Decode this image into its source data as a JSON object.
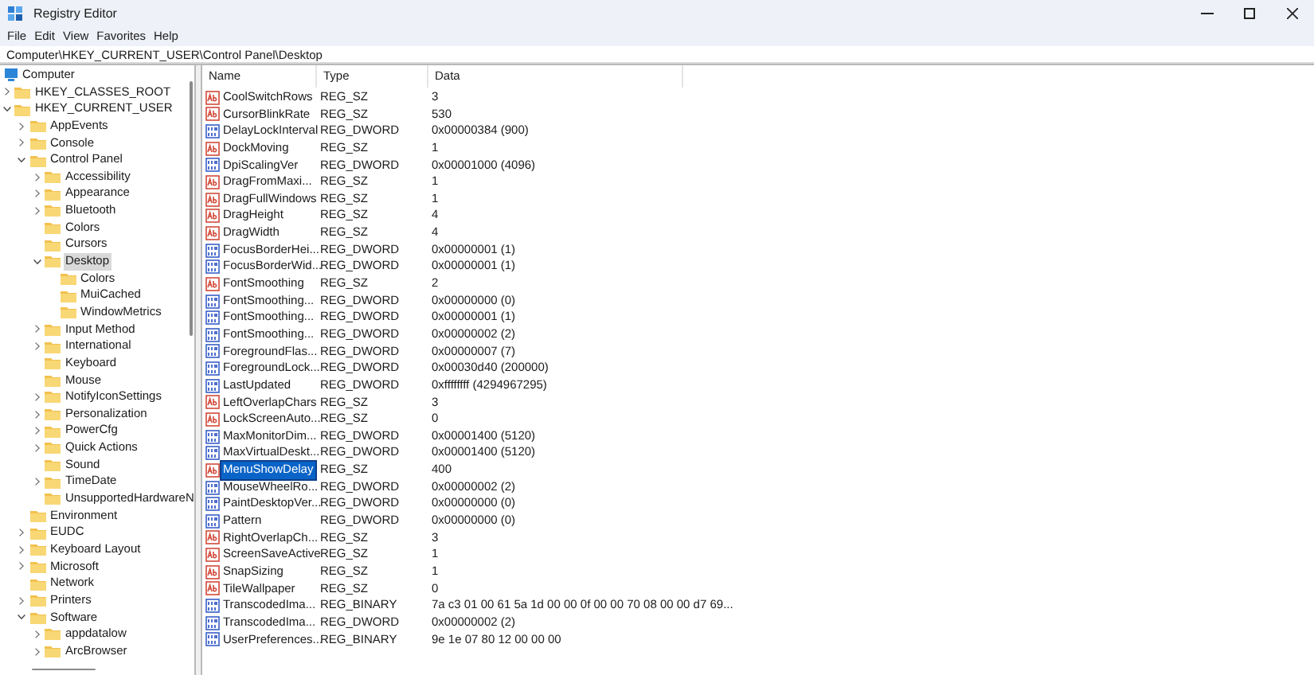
{
  "window": {
    "title": "Registry Editor"
  },
  "menu": [
    "File",
    "Edit",
    "View",
    "Favorites",
    "Help"
  ],
  "address": "Computer\\HKEY_CURRENT_USER\\Control Panel\\Desktop",
  "tree": {
    "root": "Computer",
    "nodes": [
      {
        "label": "HKEY_CLASSES_ROOT",
        "expandable": true,
        "expanded": false,
        "selected": false
      },
      {
        "label": "HKEY_CURRENT_USER",
        "expandable": true,
        "expanded": true,
        "selected": false,
        "children": [
          {
            "label": "AppEvents",
            "expandable": true,
            "expanded": false,
            "selected": false
          },
          {
            "label": "Console",
            "expandable": true,
            "expanded": false,
            "selected": false
          },
          {
            "label": "Control Panel",
            "expandable": true,
            "expanded": true,
            "selected": false,
            "children": [
              {
                "label": "Accessibility",
                "expandable": true,
                "expanded": false,
                "selected": false
              },
              {
                "label": "Appearance",
                "expandable": true,
                "expanded": false,
                "selected": false
              },
              {
                "label": "Bluetooth",
                "expandable": true,
                "expanded": false,
                "selected": false
              },
              {
                "label": "Colors",
                "expandable": false,
                "expanded": false,
                "selected": false
              },
              {
                "label": "Cursors",
                "expandable": false,
                "expanded": false,
                "selected": false
              },
              {
                "label": "Desktop",
                "expandable": true,
                "expanded": true,
                "selected": true,
                "children": [
                  {
                    "label": "Colors",
                    "expandable": false,
                    "expanded": false,
                    "selected": false
                  },
                  {
                    "label": "MuiCached",
                    "expandable": false,
                    "expanded": false,
                    "selected": false
                  },
                  {
                    "label": "WindowMetrics",
                    "expandable": false,
                    "expanded": false,
                    "selected": false
                  }
                ]
              },
              {
                "label": "Input Method",
                "expandable": true,
                "expanded": false,
                "selected": false
              },
              {
                "label": "International",
                "expandable": true,
                "expanded": false,
                "selected": false
              },
              {
                "label": "Keyboard",
                "expandable": false,
                "expanded": false,
                "selected": false
              },
              {
                "label": "Mouse",
                "expandable": false,
                "expanded": false,
                "selected": false
              },
              {
                "label": "NotifyIconSettings",
                "expandable": true,
                "expanded": false,
                "selected": false
              },
              {
                "label": "Personalization",
                "expandable": true,
                "expanded": false,
                "selected": false
              },
              {
                "label": "PowerCfg",
                "expandable": true,
                "expanded": false,
                "selected": false
              },
              {
                "label": "Quick Actions",
                "expandable": true,
                "expanded": false,
                "selected": false
              },
              {
                "label": "Sound",
                "expandable": false,
                "expanded": false,
                "selected": false
              },
              {
                "label": "TimeDate",
                "expandable": true,
                "expanded": false,
                "selected": false
              },
              {
                "label": "UnsupportedHardwareN",
                "expandable": false,
                "expanded": false,
                "selected": false
              }
            ]
          },
          {
            "label": "Environment",
            "expandable": false,
            "expanded": false,
            "selected": false
          },
          {
            "label": "EUDC",
            "expandable": true,
            "expanded": false,
            "selected": false
          },
          {
            "label": "Keyboard Layout",
            "expandable": true,
            "expanded": false,
            "selected": false
          },
          {
            "label": "Microsoft",
            "expandable": true,
            "expanded": false,
            "selected": false
          },
          {
            "label": "Network",
            "expandable": false,
            "expanded": false,
            "selected": false
          },
          {
            "label": "Printers",
            "expandable": true,
            "expanded": false,
            "selected": false
          },
          {
            "label": "Software",
            "expandable": true,
            "expanded": true,
            "selected": false,
            "children": [
              {
                "label": "appdatalow",
                "expandable": true,
                "expanded": false,
                "selected": false
              },
              {
                "label": "ArcBrowser",
                "expandable": true,
                "expanded": false,
                "selected": false
              }
            ]
          }
        ]
      }
    ]
  },
  "table": {
    "columns": [
      "Name",
      "Type",
      "Data"
    ],
    "rows": [
      {
        "kind": "string",
        "name": "CoolSwitchRows",
        "type": "REG_SZ",
        "data": "3",
        "selected": false
      },
      {
        "kind": "string",
        "name": "CursorBlinkRate",
        "type": "REG_SZ",
        "data": "530",
        "selected": false
      },
      {
        "kind": "binary",
        "name": "DelayLockInterval",
        "type": "REG_DWORD",
        "data": "0x00000384 (900)",
        "selected": false
      },
      {
        "kind": "string",
        "name": "DockMoving",
        "type": "REG_SZ",
        "data": "1",
        "selected": false
      },
      {
        "kind": "binary",
        "name": "DpiScalingVer",
        "type": "REG_DWORD",
        "data": "0x00001000 (4096)",
        "selected": false
      },
      {
        "kind": "string",
        "name": "DragFromMaxi...",
        "type": "REG_SZ",
        "data": "1",
        "selected": false
      },
      {
        "kind": "string",
        "name": "DragFullWindows",
        "type": "REG_SZ",
        "data": "1",
        "selected": false
      },
      {
        "kind": "string",
        "name": "DragHeight",
        "type": "REG_SZ",
        "data": "4",
        "selected": false
      },
      {
        "kind": "string",
        "name": "DragWidth",
        "type": "REG_SZ",
        "data": "4",
        "selected": false
      },
      {
        "kind": "binary",
        "name": "FocusBorderHei...",
        "type": "REG_DWORD",
        "data": "0x00000001 (1)",
        "selected": false
      },
      {
        "kind": "binary",
        "name": "FocusBorderWid...",
        "type": "REG_DWORD",
        "data": "0x00000001 (1)",
        "selected": false
      },
      {
        "kind": "string",
        "name": "FontSmoothing",
        "type": "REG_SZ",
        "data": "2",
        "selected": false
      },
      {
        "kind": "binary",
        "name": "FontSmoothing...",
        "type": "REG_DWORD",
        "data": "0x00000000 (0)",
        "selected": false
      },
      {
        "kind": "binary",
        "name": "FontSmoothing...",
        "type": "REG_DWORD",
        "data": "0x00000001 (1)",
        "selected": false
      },
      {
        "kind": "binary",
        "name": "FontSmoothing...",
        "type": "REG_DWORD",
        "data": "0x00000002 (2)",
        "selected": false
      },
      {
        "kind": "binary",
        "name": "ForegroundFlas...",
        "type": "REG_DWORD",
        "data": "0x00000007 (7)",
        "selected": false
      },
      {
        "kind": "binary",
        "name": "ForegroundLock...",
        "type": "REG_DWORD",
        "data": "0x00030d40 (200000)",
        "selected": false
      },
      {
        "kind": "binary",
        "name": "LastUpdated",
        "type": "REG_DWORD",
        "data": "0xffffffff (4294967295)",
        "selected": false
      },
      {
        "kind": "string",
        "name": "LeftOverlapChars",
        "type": "REG_SZ",
        "data": "3",
        "selected": false
      },
      {
        "kind": "string",
        "name": "LockScreenAuto...",
        "type": "REG_SZ",
        "data": "0",
        "selected": false
      },
      {
        "kind": "binary",
        "name": "MaxMonitorDim...",
        "type": "REG_DWORD",
        "data": "0x00001400 (5120)",
        "selected": false
      },
      {
        "kind": "binary",
        "name": "MaxVirtualDeskt...",
        "type": "REG_DWORD",
        "data": "0x00001400 (5120)",
        "selected": false
      },
      {
        "kind": "string",
        "name": "MenuShowDelay",
        "type": "REG_SZ",
        "data": "400",
        "selected": true
      },
      {
        "kind": "binary",
        "name": "MouseWheelRo...",
        "type": "REG_DWORD",
        "data": "0x00000002 (2)",
        "selected": false
      },
      {
        "kind": "binary",
        "name": "PaintDesktopVer...",
        "type": "REG_DWORD",
        "data": "0x00000000 (0)",
        "selected": false
      },
      {
        "kind": "binary",
        "name": "Pattern",
        "type": "REG_DWORD",
        "data": "0x00000000 (0)",
        "selected": false
      },
      {
        "kind": "string",
        "name": "RightOverlapCh...",
        "type": "REG_SZ",
        "data": "3",
        "selected": false
      },
      {
        "kind": "string",
        "name": "ScreenSaveActive",
        "type": "REG_SZ",
        "data": "1",
        "selected": false
      },
      {
        "kind": "string",
        "name": "SnapSizing",
        "type": "REG_SZ",
        "data": "1",
        "selected": false
      },
      {
        "kind": "string",
        "name": "TileWallpaper",
        "type": "REG_SZ",
        "data": "0",
        "selected": false
      },
      {
        "kind": "binary",
        "name": "TranscodedIma...",
        "type": "REG_BINARY",
        "data": "7a c3 01 00 61 5a 1d 00 00 0f 00 00 70 08 00 00 d7 69...",
        "selected": false
      },
      {
        "kind": "binary",
        "name": "TranscodedIma...",
        "type": "REG_DWORD",
        "data": "0x00000002 (2)",
        "selected": false
      },
      {
        "kind": "binary",
        "name": "UserPreferences...",
        "type": "REG_BINARY",
        "data": "9e 1e 07 80 12 00 00 00",
        "selected": false
      }
    ]
  }
}
